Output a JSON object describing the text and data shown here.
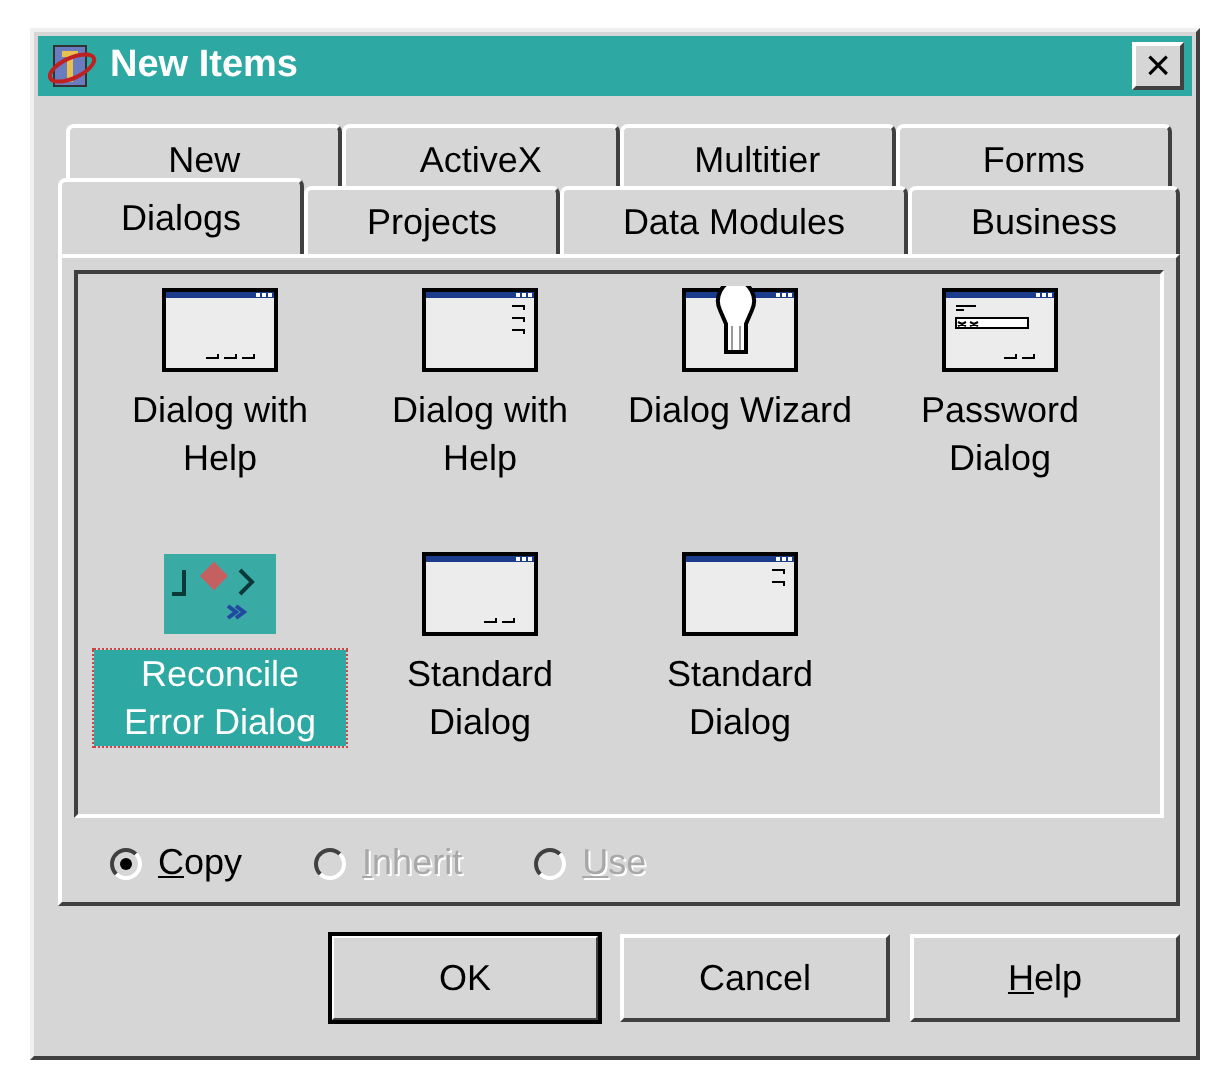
{
  "window": {
    "title": "New Items",
    "close": "×"
  },
  "tab_rows": [
    [
      {
        "label": "New",
        "selected": false
      },
      {
        "label": "ActiveX",
        "selected": false
      },
      {
        "label": "Multitier",
        "selected": false
      },
      {
        "label": "Forms",
        "selected": false
      }
    ],
    [
      {
        "label": "Dialogs",
        "selected": true
      },
      {
        "label": "Projects",
        "selected": false
      },
      {
        "label": "Data Modules",
        "selected": false
      },
      {
        "label": "Business",
        "selected": false
      }
    ]
  ],
  "items": [
    {
      "label": "Dialog with Help",
      "kind": "bottom3",
      "selected": false
    },
    {
      "label": "Dialog with Help",
      "kind": "right3",
      "selected": false
    },
    {
      "label": "Dialog Wizard",
      "kind": "wizard",
      "selected": false
    },
    {
      "label": "Password Dialog",
      "kind": "password",
      "selected": false
    },
    {
      "label": "Reconcile Error Dialog",
      "kind": "reconcile",
      "selected": true
    },
    {
      "label": "Standard Dialog",
      "kind": "bottom2",
      "selected": false
    },
    {
      "label": "Standard Dialog",
      "kind": "right2",
      "selected": false
    }
  ],
  "options": [
    {
      "label": "Copy",
      "checked": true,
      "disabled": false,
      "mnemonic": true
    },
    {
      "label": "Inherit",
      "checked": false,
      "disabled": true,
      "mnemonic": true
    },
    {
      "label": "Use",
      "checked": false,
      "disabled": true,
      "mnemonic": true
    }
  ],
  "buttons": [
    {
      "label": "OK",
      "default": true,
      "mnemonic": false
    },
    {
      "label": "Cancel",
      "default": false,
      "mnemonic": false
    },
    {
      "label": "Help",
      "default": false,
      "mnemonic": true
    }
  ]
}
